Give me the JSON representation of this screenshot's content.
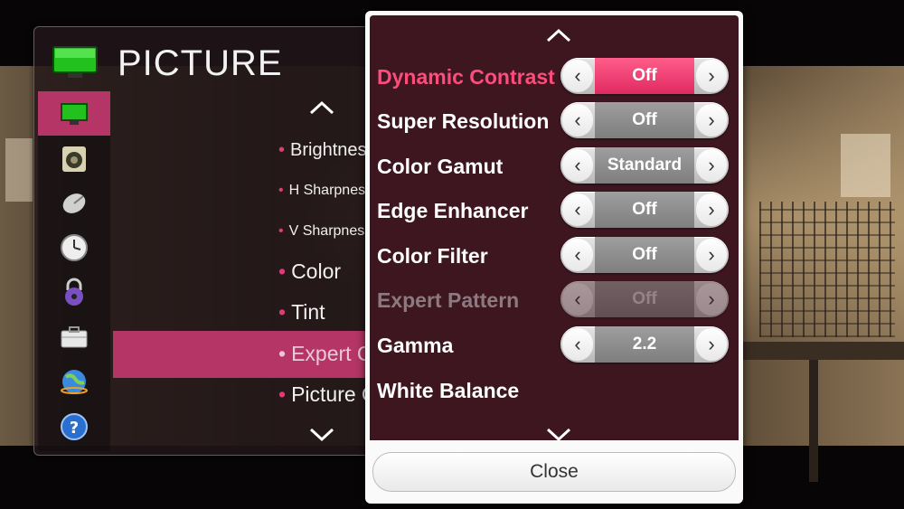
{
  "menu": {
    "title": "PICTURE",
    "side_icons": [
      "tv-icon",
      "speaker-icon",
      "satellite-dish-icon",
      "clock-icon",
      "lock-icon",
      "toolbox-icon",
      "globe-icon",
      "help-icon"
    ],
    "sub_items": [
      {
        "label": "Brightness",
        "size": "small"
      },
      {
        "label": "H Sharpness",
        "size": "tiny"
      },
      {
        "label": "V Sharpness",
        "size": "tiny"
      },
      {
        "label": "Color",
        "size": "large"
      },
      {
        "label": "Tint",
        "size": "large"
      },
      {
        "label": "Expert Control",
        "size": "large"
      },
      {
        "label": "Picture Option",
        "size": "large"
      }
    ]
  },
  "expert": {
    "rows": [
      {
        "label": "Dynamic Contrast",
        "value": "Off",
        "state": "highlight"
      },
      {
        "label": "Super Resolution",
        "value": "Off",
        "state": "normal"
      },
      {
        "label": "Color Gamut",
        "value": "Standard",
        "state": "normal"
      },
      {
        "label": "Edge Enhancer",
        "value": "Off",
        "state": "normal"
      },
      {
        "label": "Color Filter",
        "value": "Off",
        "state": "normal"
      },
      {
        "label": "Expert Pattern",
        "value": "Off",
        "state": "disabled"
      },
      {
        "label": "Gamma",
        "value": "2.2",
        "state": "normal"
      },
      {
        "label": "White Balance",
        "value": null,
        "state": "normal"
      }
    ],
    "close_label": "Close"
  },
  "colors": {
    "accent": "#b53566",
    "highlight_text": "#ff4c7a",
    "panel_bg": "#3d1620"
  }
}
